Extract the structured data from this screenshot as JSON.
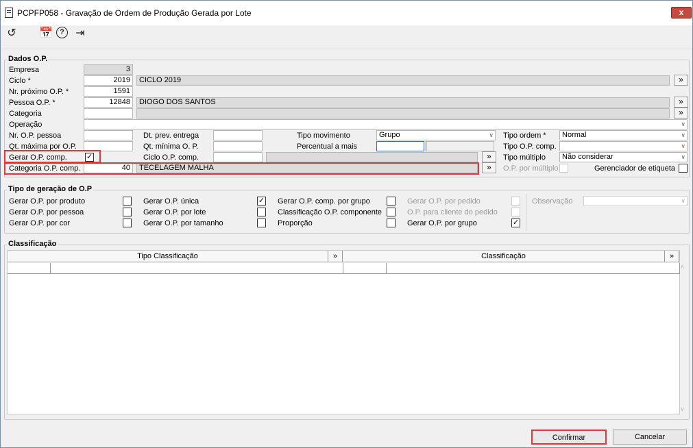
{
  "window": {
    "title": "PCPFP058 - Gravação de Ordem de Produção Gerada por Lote",
    "close": "x"
  },
  "dados": {
    "title": "Dados O.P.",
    "empresa": {
      "label": "Empresa",
      "value": "3"
    },
    "ciclo": {
      "label": "Ciclo *",
      "value": "2019",
      "desc": "CICLO 2019"
    },
    "nr_proximo": {
      "label": "Nr. próximo O.P. *",
      "value": "1591"
    },
    "pessoa": {
      "label": "Pessoa O.P. *",
      "value": "12848",
      "desc": "DIOGO DOS SANTOS"
    },
    "categoria": {
      "label": "Categoria",
      "value": "",
      "desc": ""
    },
    "operacao": {
      "label": "Operação",
      "value": ""
    },
    "nr_op_pessoa": {
      "label": "Nr. O.P. pessoa"
    },
    "qt_maxima": {
      "label": "Qt. máxima por O.P."
    },
    "gerar_comp": {
      "label": "Gerar O.P. comp."
    },
    "categoria_comp": {
      "label": "Categoria O.P. comp.",
      "value": "40",
      "desc": "TECELAGEM MALHA"
    },
    "dt_prev": {
      "label": "Dt. prev. entrega"
    },
    "qt_minima": {
      "label": "Qt. mínima O. P."
    },
    "ciclo_comp": {
      "label": "Ciclo O.P. comp."
    },
    "tipo_movimento": {
      "label": "Tipo movimento",
      "value": "Grupo"
    },
    "percentual": {
      "label": "Percentual a mais"
    },
    "tipo_ordem": {
      "label": "Tipo ordem *",
      "value": "Normal"
    },
    "tipo_op_comp": {
      "label": "Tipo O.P. comp.",
      "value": ""
    },
    "tipo_multiplo": {
      "label": "Tipo múltiplo",
      "value": "Não considerar"
    },
    "op_por_multiplo": {
      "label": "O.P. por múltiplo"
    },
    "gerenciador": {
      "label": "Gerenciador de etiqueta"
    },
    "lookup": "»"
  },
  "tipo_geracao": {
    "title": "Tipo de geração de O.P",
    "col1": [
      "Gerar O.P. por produto",
      "Gerar O.P. por pessoa",
      "Gerar O.P. por cor"
    ],
    "col2": [
      "Gerar O.P. única",
      "Gerar O.P. por lote",
      "Gerar O.P. por tamanho"
    ],
    "col3": [
      "Gerar O.P. comp. por grupo",
      "Classificação O.P. componente",
      "Proporção"
    ],
    "col4": [
      "Gerar O.P. por pedido",
      "O.P. para cliente do pedido",
      "Gerar O.P. por grupo"
    ],
    "observacao": "Observação"
  },
  "classificacao": {
    "title": "Classificação",
    "col1": "Tipo Classificação",
    "col2": "Classificação"
  },
  "footer": {
    "confirm": "Confirmar",
    "cancel": "Cancelar"
  },
  "colors": {
    "highlight": "#d93a3a"
  }
}
